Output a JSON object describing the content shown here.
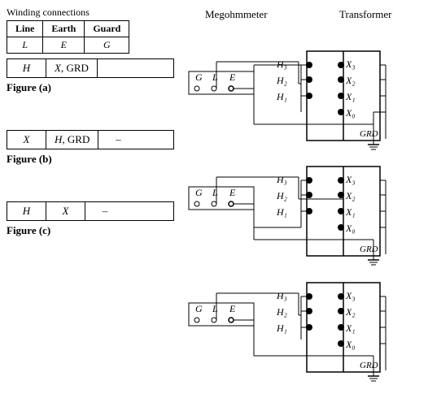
{
  "winding": {
    "title": "Winding connections",
    "headers": [
      "Line",
      "Earth",
      "Guard"
    ],
    "values": [
      "L",
      "E",
      "G"
    ]
  },
  "figures": [
    {
      "id": "a",
      "label": "Figure (a)",
      "conn": [
        "H",
        "X, GRD",
        ""
      ]
    },
    {
      "id": "b",
      "label": "Figure (b)",
      "conn": [
        "X",
        "H, GRD",
        "–"
      ]
    },
    {
      "id": "c",
      "label": "Figure (c)",
      "conn": [
        "H",
        "X",
        "–"
      ]
    }
  ],
  "megohmmeter_label": "Megohmmeter",
  "transformer_label": "Transformer"
}
